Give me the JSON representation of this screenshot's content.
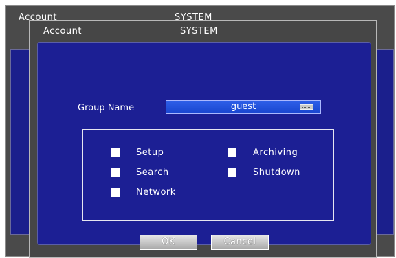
{
  "background_window": {
    "title_left": "Account",
    "title_center": "SYSTEM"
  },
  "dialog": {
    "title_left": "Account",
    "title_center": "SYSTEM",
    "group_name_label": "Group Name",
    "group_name_value": "guest",
    "permissions": [
      {
        "label": "Setup",
        "checked": false
      },
      {
        "label": "Search",
        "checked": false
      },
      {
        "label": "Network",
        "checked": false
      },
      {
        "label": "Archiving",
        "checked": false
      },
      {
        "label": "Shutdown",
        "checked": false
      }
    ],
    "ok_label": "OK",
    "cancel_label": "Cancel"
  },
  "colors": {
    "panel_blue": "#1c1f94",
    "field_blue": "#1f4fd8",
    "window_gray": "#464646"
  },
  "icons": [
    "keyboard-icon",
    "checkbox-icon"
  ]
}
